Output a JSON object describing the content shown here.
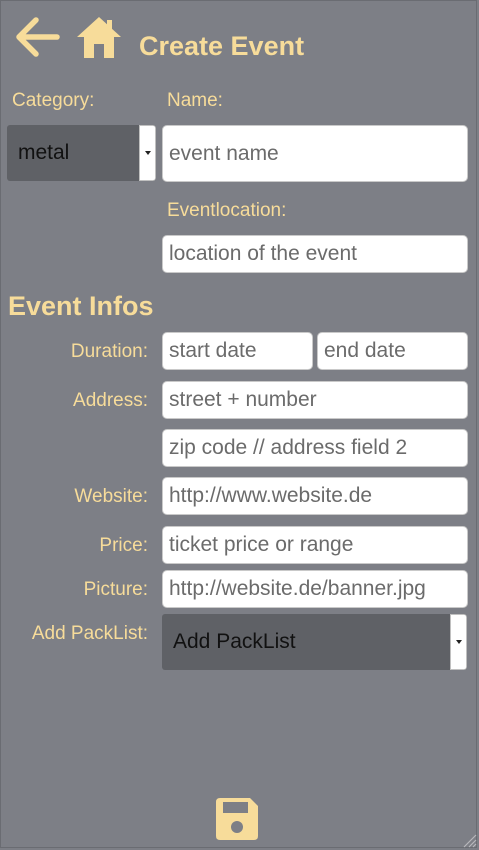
{
  "header": {
    "back_icon": "arrow-left-icon",
    "home_icon": "home-icon",
    "title": "Create Event"
  },
  "form": {
    "category_label": "Category:",
    "category_value": "metal",
    "name_label": "Name:",
    "name_placeholder": "event name",
    "location_label": "Eventlocation:",
    "location_placeholder": "location of the event",
    "section_title": "Event Infos",
    "duration_label": "Duration:",
    "start_placeholder": "start date",
    "end_placeholder": "end date",
    "address_label": "Address:",
    "street_placeholder": "street + number",
    "zip_placeholder": "zip code // address field 2",
    "website_label": "Website:",
    "website_placeholder": "http://www.website.de",
    "price_label": "Price:",
    "price_placeholder": "ticket price or range",
    "picture_label": "Picture:",
    "picture_placeholder": "http://website.de/banner.jpg",
    "packlist_label": "Add PackList:",
    "packlist_value": "Add PackList"
  },
  "footer": {
    "save_icon": "floppy-disk-icon"
  },
  "colors": {
    "background": "#7d7f86",
    "accent": "#f7dc9a",
    "select_bg": "#5f6166"
  }
}
